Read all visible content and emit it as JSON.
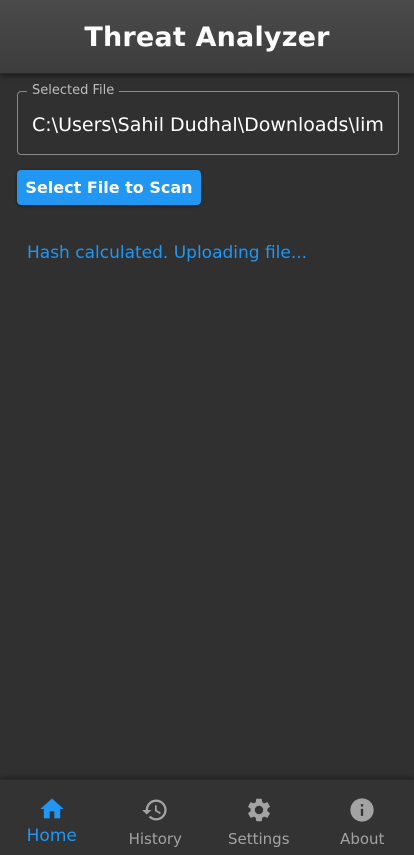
{
  "app": {
    "title": "Threat Analyzer"
  },
  "file_picker": {
    "label": "Selected File",
    "value": "C:\\Users\\Sahil Dudhal\\Downloads\\limkedin.png",
    "button_label": "Select File to Scan"
  },
  "status": {
    "message": "Hash calculated. Uploading file..."
  },
  "nav": {
    "active": "Home",
    "items": [
      {
        "label": "Home",
        "icon": "home-icon"
      },
      {
        "label": "History",
        "icon": "history-icon"
      },
      {
        "label": "Settings",
        "icon": "settings-icon"
      },
      {
        "label": "About",
        "icon": "info-icon"
      }
    ]
  },
  "colors": {
    "accent": "#2196f3",
    "background": "#303030",
    "header": "#424242",
    "inactive_nav": "#a3a3a3"
  }
}
